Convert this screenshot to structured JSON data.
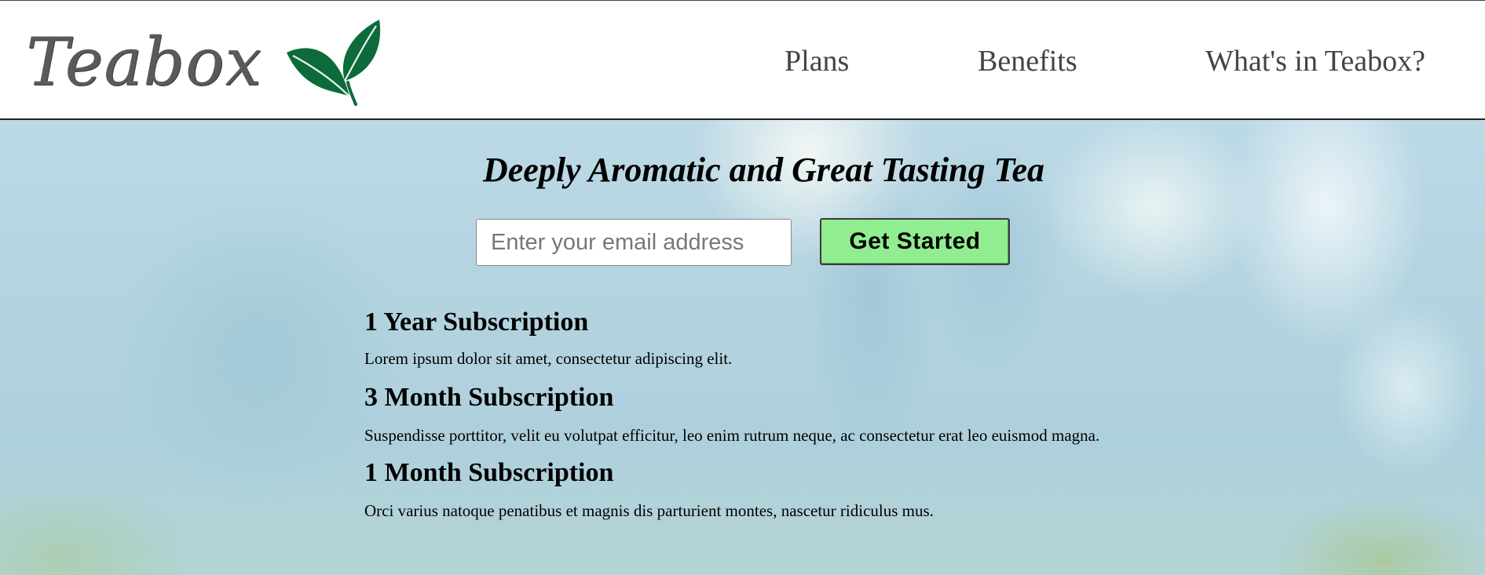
{
  "header": {
    "logo_text": "Teabox",
    "logo_icon": "tea-leaves-icon",
    "nav": [
      {
        "label": "Plans"
      },
      {
        "label": "Benefits"
      },
      {
        "label": "What's in Teabox?"
      }
    ]
  },
  "hero": {
    "title": "Deeply Aromatic and Great Tasting Tea",
    "email_placeholder": "Enter your email address",
    "email_value": "",
    "cta_label": "Get Started"
  },
  "plans": [
    {
      "title": "1 Year Subscription",
      "description": "Lorem ipsum dolor sit amet, consectetur adipiscing elit."
    },
    {
      "title": "3 Month Subscription",
      "description": "Suspendisse porttitor, velit eu volutpat efficitur, leo enim rutrum neque, ac consectetur erat leo euismod magna."
    },
    {
      "title": "1 Month Subscription",
      "description": "Orci varius natoque penatibus et magnis dis parturient montes, nascetur ridiculus mus."
    }
  ],
  "colors": {
    "cta_background": "#90ee90",
    "leaf_green": "#0d6b3a",
    "nav_text": "#444444",
    "logo_text": "#5a5a5a"
  }
}
